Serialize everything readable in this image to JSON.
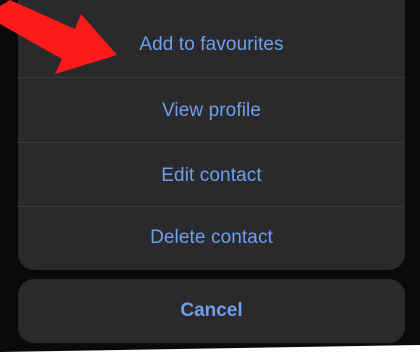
{
  "action_sheet": {
    "items": [
      {
        "label": "Add to favourites"
      },
      {
        "label": "View profile"
      },
      {
        "label": "Edit contact"
      },
      {
        "label": "Delete contact"
      }
    ],
    "cancel_label": "Cancel"
  },
  "colors": {
    "background": "#0a0a0c",
    "sheet": "#2a2a2d",
    "divider": "#3b3b3f",
    "action_text": "#6e9fee",
    "annotation_arrow": "#ff1a1a"
  },
  "annotation": {
    "icon": "red-arrow-icon"
  }
}
